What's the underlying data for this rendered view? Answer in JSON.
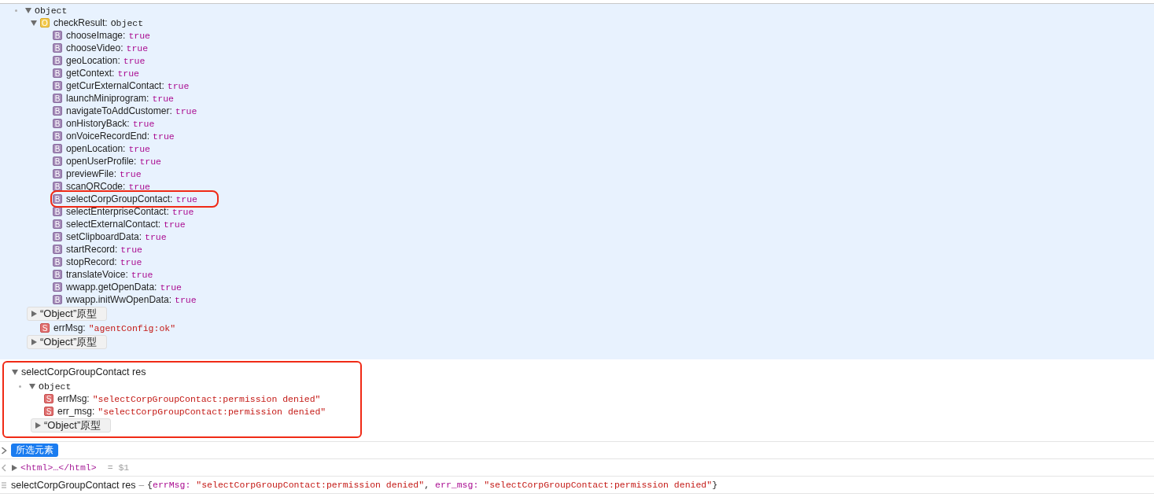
{
  "console": {
    "entries": [
      {
        "selected": true,
        "highlighted": false,
        "object": {
          "label": "Object",
          "expanded": true,
          "properties": [
            {
              "name": "checkResult:",
              "type": "O",
              "value": "Object",
              "expanded": true,
              "highlighted": false,
              "properties": [
                {
                  "name": "chooseImage:",
                  "type": "B",
                  "value": "true",
                  "highlighted": false
                },
                {
                  "name": "chooseVideo:",
                  "type": "B",
                  "value": "true",
                  "highlighted": false
                },
                {
                  "name": "geoLocation:",
                  "type": "B",
                  "value": "true",
                  "highlighted": false
                },
                {
                  "name": "getContext:",
                  "type": "B",
                  "value": "true",
                  "highlighted": false
                },
                {
                  "name": "getCurExternalContact:",
                  "type": "B",
                  "value": "true",
                  "highlighted": false
                },
                {
                  "name": "launchMiniprogram:",
                  "type": "B",
                  "value": "true",
                  "highlighted": false
                },
                {
                  "name": "navigateToAddCustomer:",
                  "type": "B",
                  "value": "true",
                  "highlighted": false
                },
                {
                  "name": "onHistoryBack:",
                  "type": "B",
                  "value": "true",
                  "highlighted": false
                },
                {
                  "name": "onVoiceRecordEnd:",
                  "type": "B",
                  "value": "true",
                  "highlighted": false
                },
                {
                  "name": "openLocation:",
                  "type": "B",
                  "value": "true",
                  "highlighted": false
                },
                {
                  "name": "openUserProfile:",
                  "type": "B",
                  "value": "true",
                  "highlighted": false
                },
                {
                  "name": "previewFile:",
                  "type": "B",
                  "value": "true",
                  "highlighted": false
                },
                {
                  "name": "scanQRCode:",
                  "type": "B",
                  "value": "true",
                  "highlighted": false
                },
                {
                  "name": "selectCorpGroupContact:",
                  "type": "B",
                  "value": "true",
                  "highlighted": true
                },
                {
                  "name": "selectEnterpriseContact:",
                  "type": "B",
                  "value": "true",
                  "highlighted": false
                },
                {
                  "name": "selectExternalContact:",
                  "type": "B",
                  "value": "true",
                  "highlighted": false
                },
                {
                  "name": "setClipboardData:",
                  "type": "B",
                  "value": "true",
                  "highlighted": false
                },
                {
                  "name": "startRecord:",
                  "type": "B",
                  "value": "true",
                  "highlighted": false
                },
                {
                  "name": "stopRecord:",
                  "type": "B",
                  "value": "true",
                  "highlighted": false
                },
                {
                  "name": "translateVoice:",
                  "type": "B",
                  "value": "true",
                  "highlighted": false
                },
                {
                  "name": "wwapp.getOpenData:",
                  "type": "B",
                  "value": "true",
                  "highlighted": false
                },
                {
                  "name": "wwapp.initWwOpenData:",
                  "type": "B",
                  "value": "true",
                  "highlighted": false
                }
              ],
              "prototype": {
                "label": "“Object”原型",
                "expanded": false
              }
            },
            {
              "name": "errMsg:",
              "type": "S",
              "value": "\"agentConfig:ok\"",
              "highlighted": false
            }
          ],
          "prototype": {
            "label": "“Object”原型",
            "expanded": false
          }
        }
      },
      {
        "selected": false,
        "highlighted": true,
        "title": "selectCorpGroupContact res",
        "expanded": true,
        "object": {
          "label": "Object",
          "expanded": true,
          "properties": [
            {
              "name": "errMsg:",
              "type": "S",
              "value": "\"selectCorpGroupContact:permission denied\"",
              "highlighted": false
            },
            {
              "name": "err_msg:",
              "type": "S",
              "value": "\"selectCorpGroupContact:permission denied\"",
              "highlighted": false
            }
          ],
          "prototype": {
            "label": "“Object”原型",
            "expanded": false
          }
        }
      }
    ],
    "selected_element": {
      "label": "所选元素"
    },
    "element_row": {
      "expanded": false,
      "element": "<html>…</html>",
      "variable": "= $1"
    },
    "summary": {
      "title": "selectCorpGroupContact res",
      "dash": "–",
      "open": "{",
      "separator": ",",
      "close": "}",
      "pairs": [
        {
          "key": "errMsg:",
          "value": "\"selectCorpGroupContact:permission denied\""
        },
        {
          "key": "err_msg:",
          "value": "\"selectCorpGroupContact:permission denied\""
        }
      ]
    }
  }
}
